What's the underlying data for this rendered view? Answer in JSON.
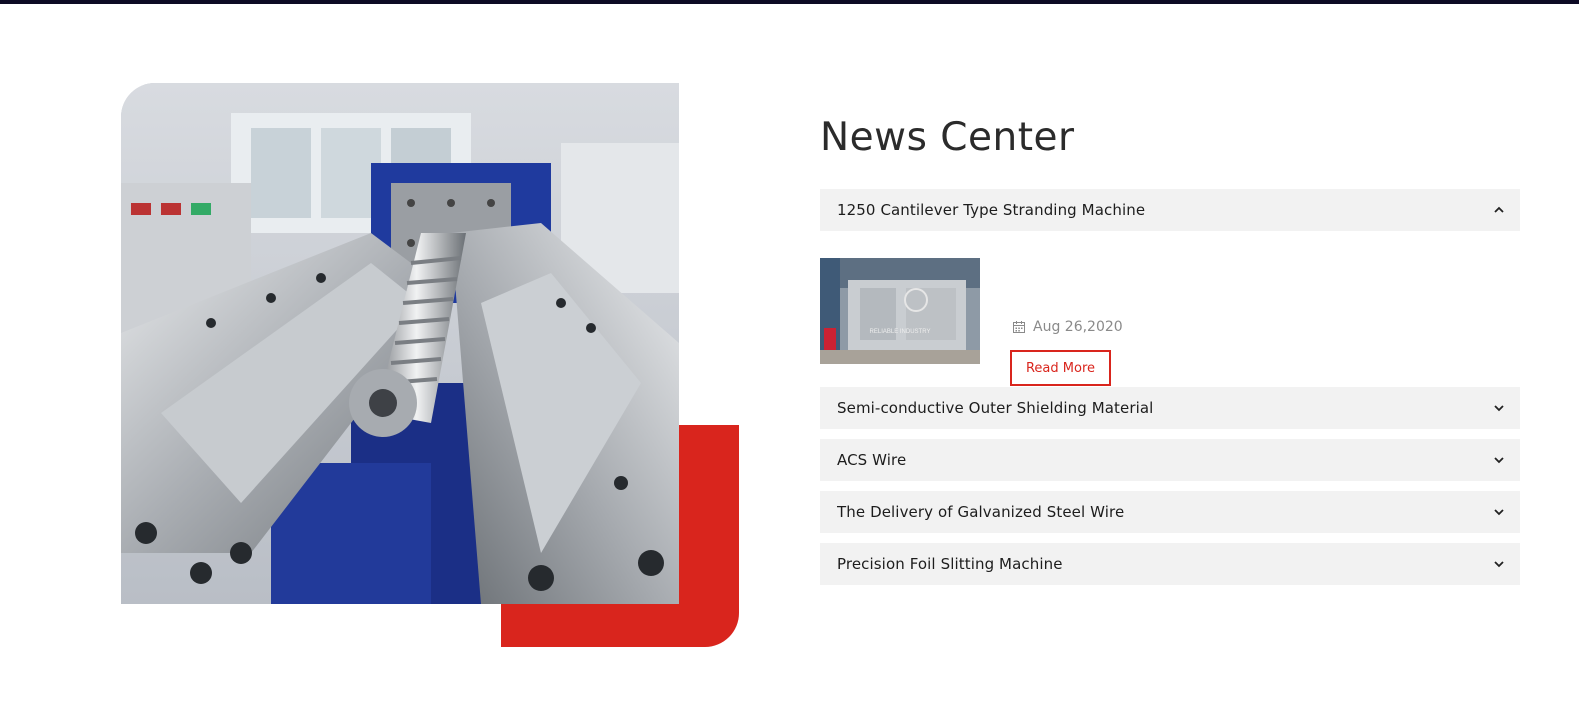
{
  "colors": {
    "accent": "#d9251d",
    "top_bar": "#0d0a24",
    "accordion_bg": "#f2f2f2",
    "date_text": "#8a8a8a"
  },
  "hero": {
    "image_subject": "industrial extruder screw and barrel machinery"
  },
  "news": {
    "title": "News Center",
    "items": [
      {
        "title": "1250 Cantilever Type Stranding Machine",
        "expanded": true,
        "icon": "chevron-up-icon",
        "date": "Aug 26,2020",
        "date_icon": "calendar-icon",
        "read_more": "Read More",
        "thumb_logo_text": "RELIABLE INDUSTRY"
      },
      {
        "title": "Semi-conductive Outer Shielding Material",
        "expanded": false,
        "icon": "chevron-down-icon"
      },
      {
        "title": "ACS Wire",
        "expanded": false,
        "icon": "chevron-down-icon"
      },
      {
        "title": "The Delivery of Galvanized Steel Wire",
        "expanded": false,
        "icon": "chevron-down-icon"
      },
      {
        "title": "Precision Foil Slitting Machine",
        "expanded": false,
        "icon": "chevron-down-icon"
      }
    ]
  }
}
